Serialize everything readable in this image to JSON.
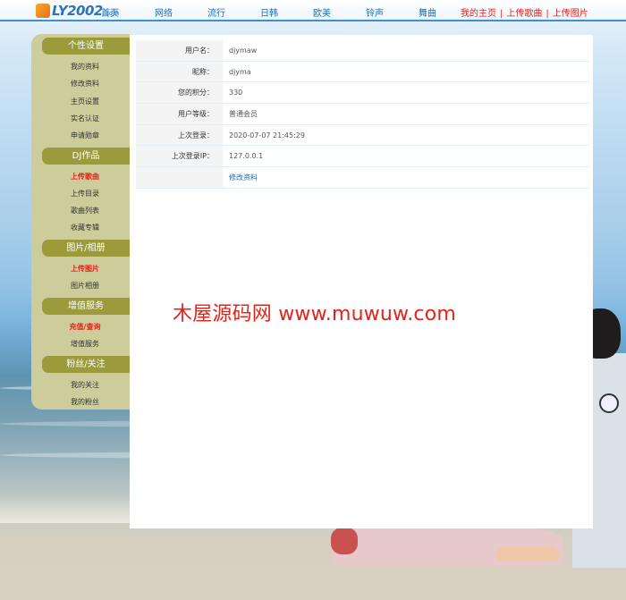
{
  "header": {
    "logo_text": "LY2002",
    "logo_domain": ".com",
    "nav": [
      "首页",
      "网络",
      "流行",
      "日韩",
      "欧美",
      "铃声",
      "舞曲"
    ],
    "user_links": [
      "我的主页",
      "上传歌曲",
      "上传图片"
    ],
    "separator": "|"
  },
  "sidebar": {
    "sections": [
      {
        "title": "个性设置",
        "items": [
          {
            "label": "我的资料",
            "hot": false
          },
          {
            "label": "修改资料",
            "hot": false
          },
          {
            "label": "主页设置",
            "hot": false
          },
          {
            "label": "实名认证",
            "hot": false
          },
          {
            "label": "申请勋章",
            "hot": false
          }
        ]
      },
      {
        "title": "DJ作品",
        "items": [
          {
            "label": "上传歌曲",
            "hot": true
          },
          {
            "label": "上传目录",
            "hot": false
          },
          {
            "label": "歌曲列表",
            "hot": false
          },
          {
            "label": "收藏专辑",
            "hot": false
          }
        ]
      },
      {
        "title": "图片/相册",
        "items": [
          {
            "label": "上传图片",
            "hot": true
          },
          {
            "label": "图片相册",
            "hot": false
          }
        ]
      },
      {
        "title": "增值服务",
        "items": [
          {
            "label": "充值/查询",
            "hot": true
          },
          {
            "label": "增值服务",
            "hot": false
          }
        ]
      },
      {
        "title": "粉丝/关注",
        "items": [
          {
            "label": "我的关注",
            "hot": false
          },
          {
            "label": "我的粉丝",
            "hot": false
          }
        ]
      }
    ]
  },
  "profile": {
    "rows": [
      {
        "label": "用户名：",
        "value": "djymaw"
      },
      {
        "label": "昵称：",
        "value": "djyma"
      },
      {
        "label": "您的积分：",
        "value": "330"
      },
      {
        "label": "用户等级：",
        "value": "普通会员"
      },
      {
        "label": "上次登录：",
        "value": "2020-07-07 21:45:29"
      },
      {
        "label": "上次登录IP：",
        "value": "127.0.0.1"
      }
    ],
    "edit_link": "修改资料"
  },
  "watermark": "木屋源码网 www.muwuw.com",
  "colors": {
    "accent_blue": "#1a6fb5",
    "hot_red": "#e2231a",
    "sidebar_bg": "#cdcd9b",
    "sidebar_head": "#9b9b3c"
  }
}
